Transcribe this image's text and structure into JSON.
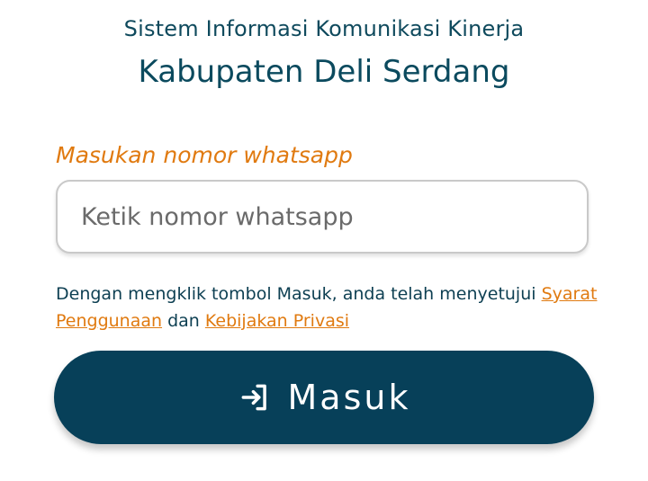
{
  "header": {
    "subtitle": "Sistem Informasi Komunikasi Kinerja",
    "title": "Kabupaten Deli Serdang"
  },
  "form": {
    "label": "Masukan nomor whatsapp",
    "phone_placeholder": "Ketik nomor whatsapp",
    "phone_value": ""
  },
  "consent": {
    "text_before": "Dengan mengklik tombol Masuk, anda telah menyetujui",
    "terms_link": "Syarat Penggunaan",
    "text_between": "dan",
    "privacy_link": "Kebijakan Privasi"
  },
  "login_button": {
    "label": "Masuk",
    "icon": "login-icon"
  },
  "colors": {
    "primary": "#074059",
    "accent": "#e07a10",
    "text": "#0d3f52"
  }
}
